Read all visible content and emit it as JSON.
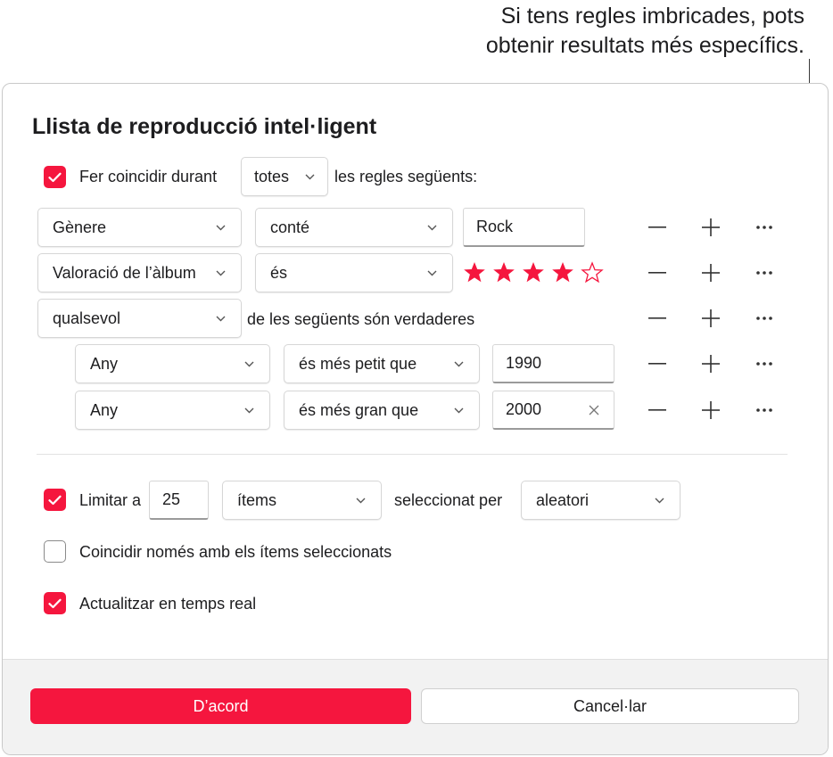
{
  "callout": {
    "line1": "Si tens regles imbricades, pots",
    "line2": "obtenir resultats més específics."
  },
  "dialog": {
    "title": "Llista de reproducció intel·ligent",
    "match": {
      "checked": true,
      "label": "Fer coincidir durant",
      "selector": "totes",
      "suffix": "les regles següents:"
    },
    "rules": [
      {
        "field": "Gènere",
        "operator": "conté",
        "value": "Rock"
      },
      {
        "field": "Valoració de l’àlbum",
        "operator": "és",
        "rating": 4,
        "rating_max": 5
      },
      {
        "field": "qualsevol",
        "text": "de les següents són verdaderes"
      }
    ],
    "nested_rules": [
      {
        "field": "Any",
        "operator": "és més petit que",
        "value": "1990"
      },
      {
        "field": "Any",
        "operator": "és més gran que",
        "value": "2000"
      }
    ],
    "limit": {
      "checked": true,
      "label": "Limitar a",
      "value": "25",
      "unit": "ítems",
      "selected_by_label": "seleccionat per",
      "selected_by": "aleatori"
    },
    "match_selected": {
      "checked": false,
      "label": "Coincidir només amb els ítems seleccionats"
    },
    "live_update": {
      "checked": true,
      "label": "Actualitzar en temps real"
    },
    "ok_button": "D’acord",
    "cancel_button": "Cancel·lar"
  },
  "colors": {
    "accent": "#f5163e"
  },
  "icons": [
    "checkmark-icon",
    "chevron-down-icon",
    "minus-icon",
    "plus-icon",
    "more-icon",
    "star-filled-icon",
    "star-outline-icon",
    "clear-icon"
  ]
}
